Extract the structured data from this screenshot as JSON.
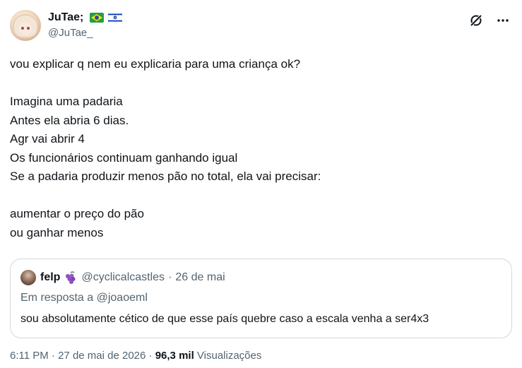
{
  "author": {
    "display_name": "JuTae;",
    "handle": "@JuTae_",
    "flags": [
      "flag-brazil",
      "flag-israel"
    ],
    "avatar": "anime-girl-avatar"
  },
  "actions": {
    "grok_icon": "grok-icon",
    "more_icon": "more-icon"
  },
  "tweet": {
    "lines": [
      "vou explicar q nem eu explicaria para uma criança ok?",
      "",
      "Imagina uma padaria",
      "Antes ela abria 6 dias.",
      "Agr vai abrir 4",
      "Os funcionários continuam ganhando igual",
      "Se a padaria produzir menos pão no total, ela vai precisar:",
      "",
      "aumentar o preço do pão",
      "ou ganhar menos"
    ]
  },
  "quote": {
    "name": "felp",
    "emoji": "grapes-emoji",
    "handle": "@cyclicalcastles",
    "separator": "·",
    "date": "26 de mai",
    "reply_to": "Em resposta a @joaoeml",
    "text": "sou absolutamente cético de que esse país quebre caso a escala venha a ser4x3"
  },
  "meta": {
    "time": "6:11 PM",
    "separator1": " · ",
    "date": "27 de mai de 2026",
    "separator2": " · ",
    "views_count": "96,3 mil",
    "views_label": " Visualizações"
  },
  "colors": {
    "text_primary": "#0f1419",
    "text_secondary": "#536471",
    "border": "#cfd9de"
  }
}
